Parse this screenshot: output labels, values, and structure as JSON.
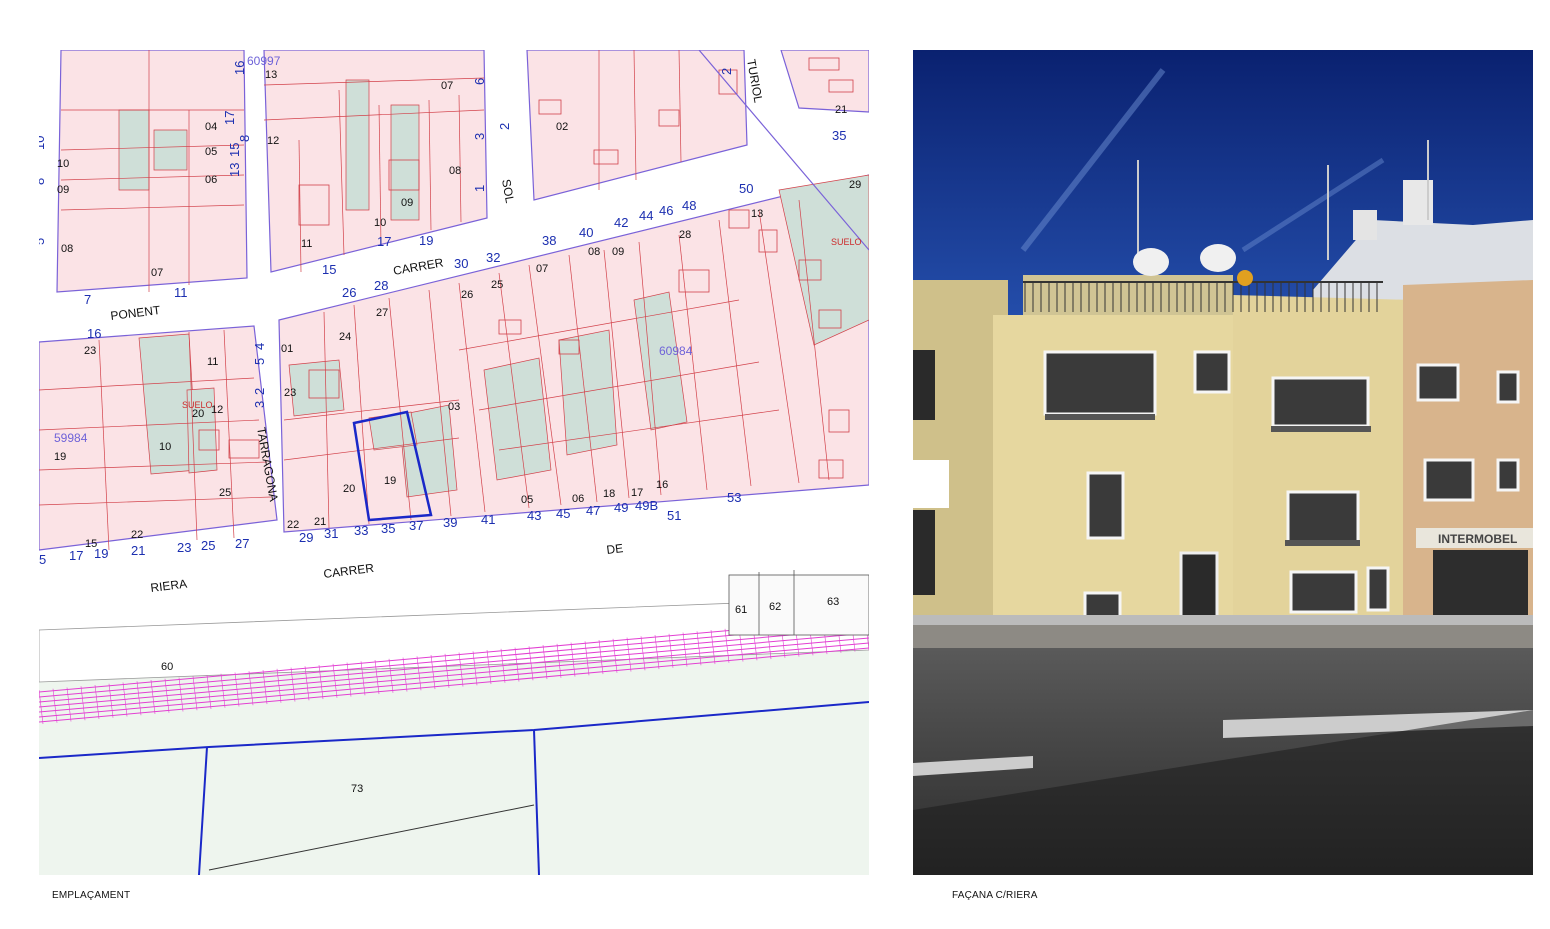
{
  "captions": {
    "map": "EMPLAÇAMENT",
    "photo": "FAÇANA C/RIERA"
  },
  "map": {
    "colors": {
      "parcel_fill": "#fbe3e6",
      "parcel_stroke": "#d2414a",
      "block_stroke": "#7a62d8",
      "patio_fill": "#cfdfd8",
      "street_number": "#1c2fb0",
      "railway": "#e23fd2",
      "highlight": "#1a28c8",
      "land_fill": "#eef5ee"
    },
    "street_names": [
      "PONENT",
      "CARRER",
      "CARRER",
      "RIERA",
      "DE",
      "SOL",
      "TARRAGONA",
      "TURIOL"
    ],
    "cadastral_ids": [
      "60997",
      "60984",
      "59984"
    ],
    "suelo_labels": [
      "SUELO",
      "SUELO"
    ],
    "street_numbers_top": [
      "26",
      "28",
      "30",
      "32",
      "38",
      "40",
      "42",
      "44",
      "46",
      "48",
      "50"
    ],
    "street_numbers_bottom": [
      "29",
      "31",
      "33",
      "35",
      "37",
      "39",
      "41",
      "43",
      "45",
      "47",
      "49",
      "49B",
      "51",
      "53"
    ],
    "street_numbers_left_block": [
      "5",
      "17",
      "19",
      "21",
      "23",
      "25",
      "27"
    ],
    "street_numbers_misc": [
      "7",
      "11",
      "15",
      "17",
      "19",
      "16",
      "10",
      "8",
      "5",
      "17",
      "8",
      "15",
      "13",
      "6",
      "3",
      "1",
      "2",
      "35",
      "4",
      "5",
      "2",
      "3",
      "16",
      "2"
    ],
    "lot_numbers_upper_left": [
      "04",
      "05",
      "06",
      "10",
      "09",
      "08",
      "07"
    ],
    "lot_numbers_upper_mid": [
      "13",
      "12",
      "07",
      "08",
      "09",
      "10",
      "11"
    ],
    "lot_numbers_upper_right": [
      "02",
      "21"
    ],
    "lot_numbers_mid": [
      "24",
      "27",
      "26",
      "25",
      "07",
      "08",
      "09",
      "28",
      "13",
      "29",
      "01",
      "23",
      "03"
    ],
    "lot_numbers_lower_left": [
      "23",
      "11",
      "20",
      "12",
      "10",
      "19",
      "25",
      "15",
      "22"
    ],
    "lot_numbers_lower_mid": [
      "19",
      "20",
      "22",
      "21",
      "05",
      "06",
      "18",
      "17",
      "16"
    ],
    "lot_numbers_south": [
      "61",
      "62",
      "63",
      "60",
      "73"
    ],
    "highlighted_parcel": "19"
  },
  "photo": {
    "colors": {
      "sky": "#0d2a78",
      "facade": "#e6d79f",
      "facade_shade": "#cfc08a",
      "road": "#4a4a4a",
      "sidewalk": "#8d8a84",
      "shop_sign": "#e9e6dc"
    },
    "shop_sign": "INTERMOBEL"
  }
}
